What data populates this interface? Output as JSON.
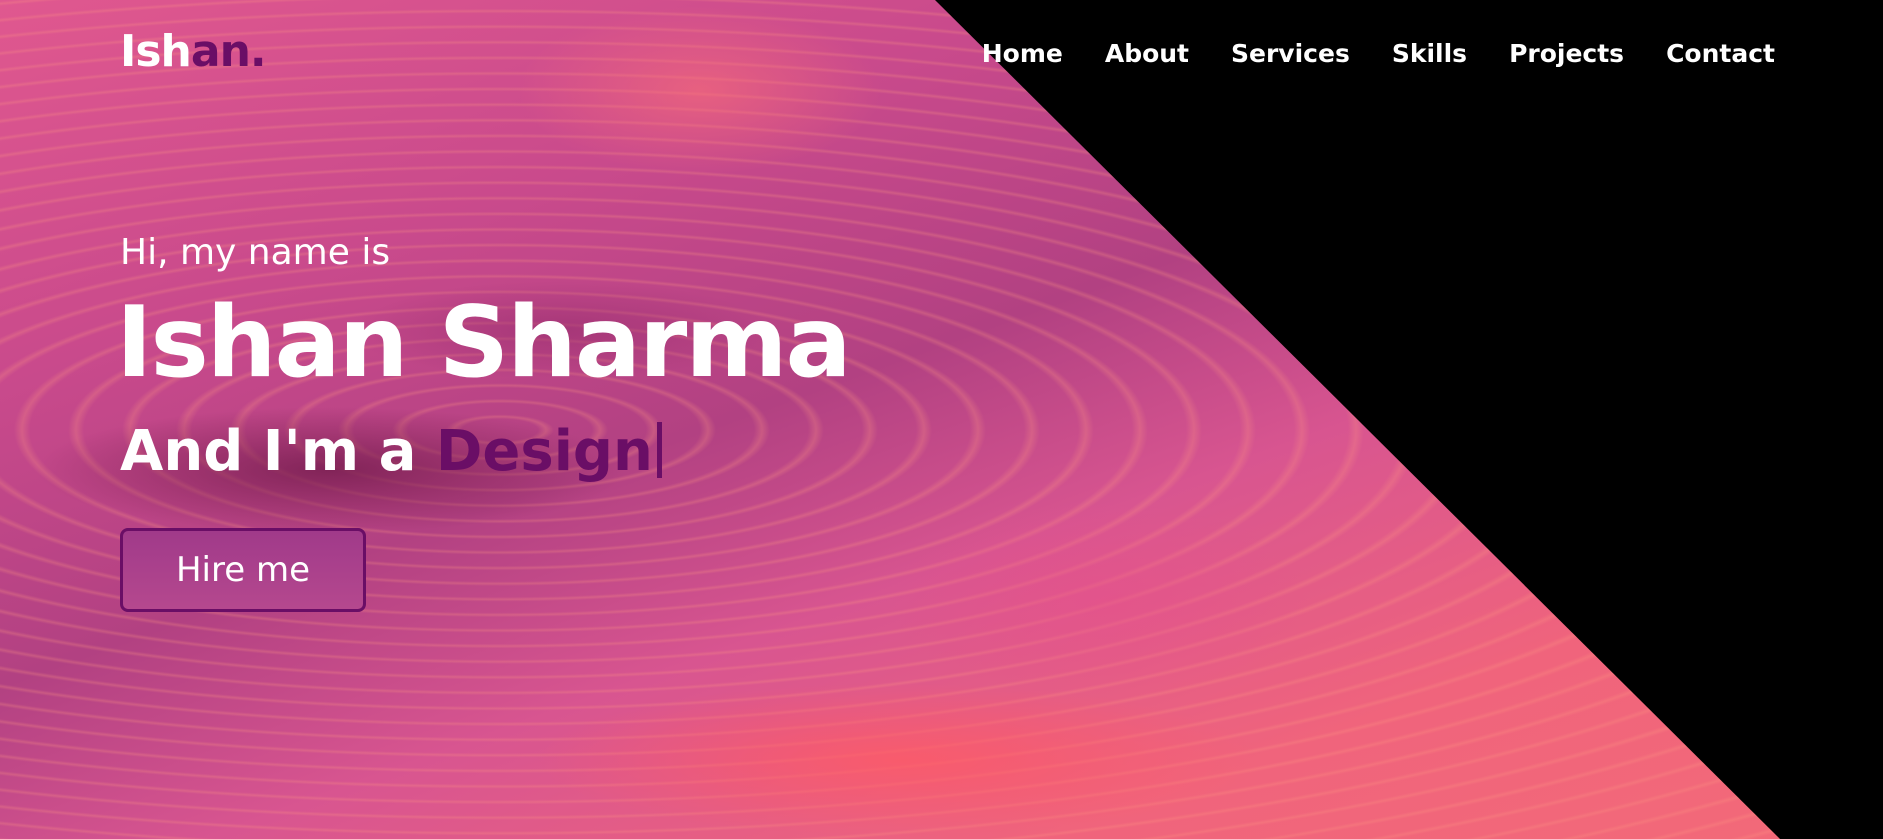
{
  "header": {
    "logo_main": "Ish",
    "logo_accent": "an."
  },
  "nav": {
    "items": [
      "Home",
      "About",
      "Services",
      "Skills",
      "Projects",
      "Contact"
    ]
  },
  "hero": {
    "greeting": "Hi, my name is",
    "name": "Ishan Sharma",
    "role_prefix": "And I'm a ",
    "role_typed": "Design",
    "cta_label": "Hire me"
  },
  "colors": {
    "accent": "#6a0e66",
    "text": "#ffffff",
    "background": "#000000",
    "hero_pink": "#e0588f",
    "hero_coral": "#f36a78"
  }
}
